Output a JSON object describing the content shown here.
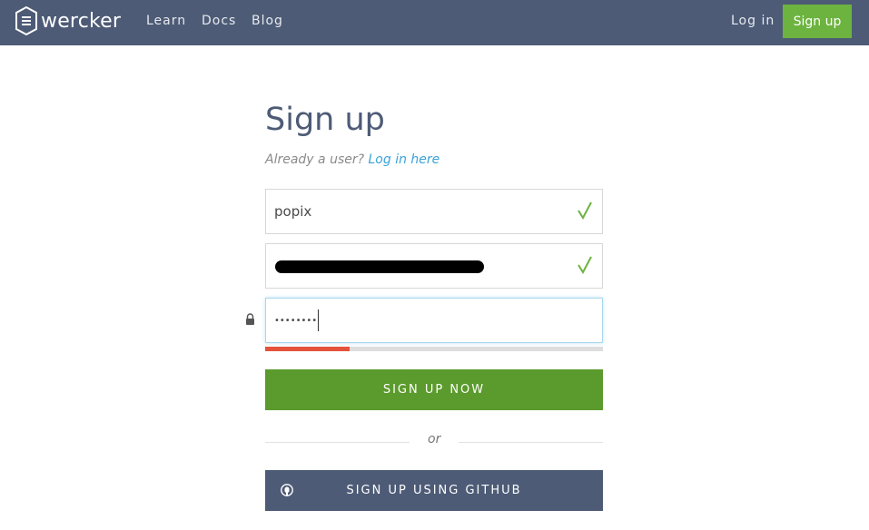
{
  "header": {
    "logo_text": "wercker",
    "nav": [
      "Learn",
      "Docs",
      "Blog"
    ],
    "login_label": "Log in",
    "signup_label": "Sign up"
  },
  "form": {
    "title": "Sign up",
    "already_user_text": "Already a user?",
    "login_link_text": "Log in here",
    "username_value": "popix",
    "password_value": "••••••••",
    "password_strength": 0.25,
    "submit_label": "SIGN UP NOW",
    "or_text": "or",
    "github_label": "SIGN UP USING GITHUB"
  },
  "colors": {
    "header_bg": "#4d5b76",
    "accent_green": "#6cb33f",
    "submit_green": "#5b9a2c",
    "strength_red": "#e5533d",
    "link_blue": "#3aa3d7"
  },
  "icons": [
    "wercker-logo-icon",
    "check-icon",
    "check-icon",
    "lock-icon",
    "github-icon"
  ]
}
